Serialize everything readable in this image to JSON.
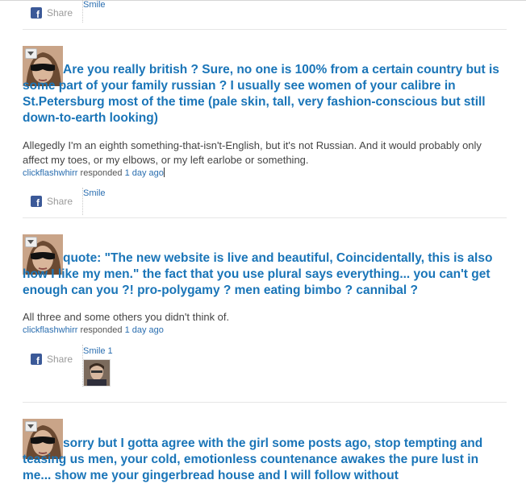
{
  "share_label": "Share",
  "facebook_glyph": "f",
  "top_item": {
    "smile_label": "Smile"
  },
  "posts": [
    {
      "question": "Are you really british ? Sure, no one is 100% from a certain country but is some part of your family russian ? I usually see women of your calibre in St.Petersburg most of the time (pale skin, tall, very fashion-conscious but still down-to-earth looking)",
      "answer": "Allegedly I'm an eighth something-that-isn't-English, but it's not Russian. And it would probably only affect my toes, or my elbows, or my left earlobe or something.",
      "username": "clickflashwhirr",
      "responded_text": "responded",
      "time": "1 day ago",
      "smile_label": "Smile"
    },
    {
      "question": "quote: \"The new website is live and beautiful, Coincidentally, this is also how I like my men.\" the fact that you use plural says everything... you can't get enough can you ?! pro-polygamy ? men eating bimbo ? cannibal ?",
      "answer": "All three and some others you didn't think of.",
      "username": "clickflashwhirr",
      "responded_text": "responded",
      "time": "1 day ago",
      "smile_label": "Smile 1"
    },
    {
      "question": "sorry but I gotta agree with the girl some posts ago, stop tempting and teasing us men, your cold, emotionless countenance awakes the pure lust in me... show me your gingerbread house and I will follow without"
    }
  ],
  "colors": {
    "link": "#1a75b8",
    "facebook": "#3b5998"
  },
  "icons": [
    "facebook-icon",
    "dropdown-triangle-icon"
  ]
}
